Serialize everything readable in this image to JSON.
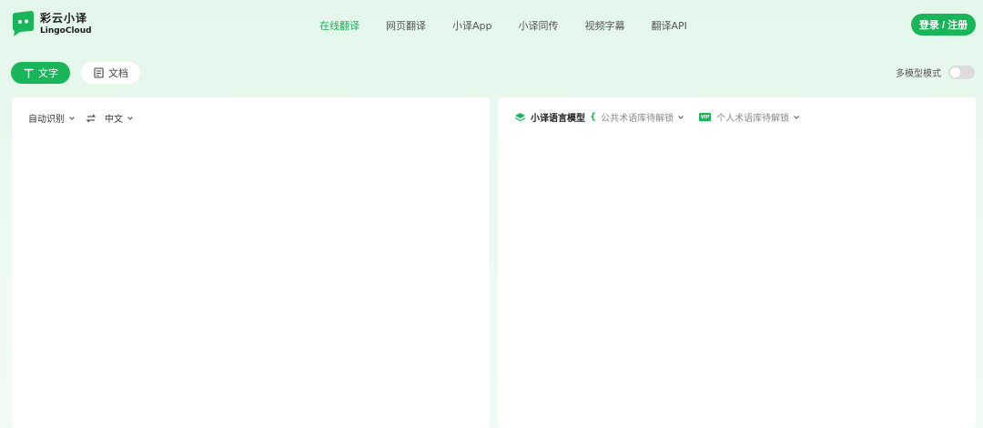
{
  "brand": {
    "name_cn": "彩云小译",
    "name_en": "LingoCloud",
    "primary_color": "#19b659"
  },
  "nav": {
    "items": [
      {
        "label": "在线翻译",
        "active": true
      },
      {
        "label": "网页翻译",
        "active": false
      },
      {
        "label": "小译App",
        "active": false
      },
      {
        "label": "小译同传",
        "active": false
      },
      {
        "label": "视频字幕",
        "active": false
      },
      {
        "label": "翻译API",
        "active": false
      }
    ],
    "login_label": "登录 / 注册"
  },
  "mode_tabs": {
    "text": {
      "label": "文字",
      "icon": "text-t-icon",
      "active": true
    },
    "document": {
      "label": "文档",
      "icon": "document-icon",
      "active": false
    }
  },
  "multi_model": {
    "label": "多模型模式",
    "enabled": false
  },
  "source_panel": {
    "source_lang": "自动识别",
    "target_lang": "中文",
    "swap_icon": "swap-arrows-icon"
  },
  "target_panel": {
    "model_name": "小译语言模型",
    "model_icon": "layers-icon",
    "public_terms": "公共术语库待解锁",
    "vip_badge": "VIP",
    "personal_terms": "个人术语库待解锁"
  }
}
